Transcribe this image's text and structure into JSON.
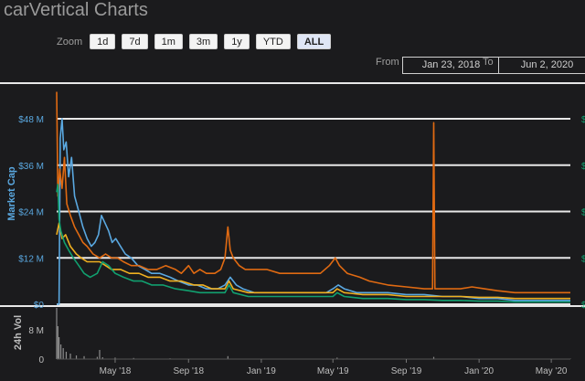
{
  "app": {
    "title": "carVertical Charts"
  },
  "zoom": {
    "label": "Zoom",
    "buttons": [
      "1d",
      "7d",
      "1m",
      "3m",
      "1y",
      "YTD",
      "ALL"
    ],
    "active": "ALL"
  },
  "range": {
    "from_label": "From",
    "from_value": "Jan 23, 2018",
    "to_label": "To",
    "to_value": "Jun 2, 2020"
  },
  "colors": {
    "market_cap": "#5aa8e0",
    "orange": "#e06a12",
    "yellow": "#f0b020",
    "green": "#11a06f",
    "grid": "#e8e8e8",
    "volume": "#8c8c8c"
  },
  "chart_data": {
    "type": "line",
    "title": "",
    "xlabel": "",
    "ylabel": "Market Cap",
    "ylabel_secondary": "24h Vol",
    "x_range": [
      "2018-01-23",
      "2020-06-02"
    ],
    "x_ticks": [
      "May '18",
      "Sep '18",
      "Jan '19",
      "May '19",
      "Sep '19",
      "Jan '20",
      "May '20"
    ],
    "y_ticks": [
      "$0",
      "$12 M",
      "$24 M",
      "$36 M",
      "$48 M"
    ],
    "ylim": [
      0,
      57
    ],
    "vol_ticks": [
      "0",
      "8 M"
    ],
    "vol_ylim": [
      0,
      14
    ],
    "right_axis_ticks": [
      "$",
      "$",
      "$",
      "$",
      "$",
      "$"
    ],
    "series": [
      {
        "color": "#5aa8e0",
        "points": [
          [
            "2018-01-23",
            0
          ],
          [
            "2018-01-27",
            0
          ],
          [
            "2018-01-29",
            43
          ],
          [
            "2018-02-01",
            48
          ],
          [
            "2018-02-04",
            40
          ],
          [
            "2018-02-08",
            42
          ],
          [
            "2018-02-12",
            33
          ],
          [
            "2018-02-17",
            38
          ],
          [
            "2018-02-22",
            28
          ],
          [
            "2018-03-01",
            24
          ],
          [
            "2018-03-08",
            20
          ],
          [
            "2018-03-15",
            17
          ],
          [
            "2018-03-22",
            15
          ],
          [
            "2018-03-28",
            16
          ],
          [
            "2018-04-03",
            18
          ],
          [
            "2018-04-08",
            23
          ],
          [
            "2018-04-14",
            21
          ],
          [
            "2018-04-20",
            19
          ],
          [
            "2018-04-26",
            16
          ],
          [
            "2018-05-02",
            17
          ],
          [
            "2018-05-10",
            15
          ],
          [
            "2018-05-18",
            13
          ],
          [
            "2018-05-28",
            12
          ],
          [
            "2018-06-08",
            10
          ],
          [
            "2018-06-20",
            9
          ],
          [
            "2018-07-01",
            8
          ],
          [
            "2018-07-15",
            8
          ],
          [
            "2018-08-01",
            7
          ],
          [
            "2018-08-15",
            6
          ],
          [
            "2018-09-01",
            5
          ],
          [
            "2018-09-15",
            5
          ],
          [
            "2018-10-01",
            4
          ],
          [
            "2018-10-20",
            4
          ],
          [
            "2018-11-01",
            5
          ],
          [
            "2018-11-10",
            7
          ],
          [
            "2018-11-20",
            5
          ],
          [
            "2018-12-01",
            4
          ],
          [
            "2018-12-20",
            3
          ],
          [
            "2019-01-10",
            3
          ],
          [
            "2019-02-01",
            3
          ],
          [
            "2019-03-01",
            3
          ],
          [
            "2019-04-01",
            3
          ],
          [
            "2019-04-20",
            3
          ],
          [
            "2019-05-01",
            4
          ],
          [
            "2019-05-10",
            5
          ],
          [
            "2019-05-20",
            4
          ],
          [
            "2019-06-10",
            3
          ],
          [
            "2019-07-01",
            3
          ],
          [
            "2019-08-01",
            3
          ],
          [
            "2019-09-01",
            2.5
          ],
          [
            "2019-10-01",
            2.5
          ],
          [
            "2019-11-01",
            2
          ],
          [
            "2019-12-01",
            2
          ],
          [
            "2020-01-01",
            1.5
          ],
          [
            "2020-02-01",
            1.5
          ],
          [
            "2020-03-01",
            1
          ],
          [
            "2020-04-01",
            1
          ],
          [
            "2020-05-01",
            1
          ],
          [
            "2020-06-02",
            1
          ]
        ]
      },
      {
        "color": "#e06a12",
        "points": [
          [
            "2018-01-23",
            55
          ],
          [
            "2018-01-25",
            28
          ],
          [
            "2018-01-28",
            35
          ],
          [
            "2018-02-01",
            30
          ],
          [
            "2018-02-05",
            38
          ],
          [
            "2018-02-09",
            26
          ],
          [
            "2018-02-15",
            23
          ],
          [
            "2018-02-22",
            20
          ],
          [
            "2018-03-01",
            18
          ],
          [
            "2018-03-08",
            16
          ],
          [
            "2018-03-15",
            15
          ],
          [
            "2018-03-25",
            13
          ],
          [
            "2018-04-05",
            12
          ],
          [
            "2018-04-15",
            13
          ],
          [
            "2018-04-25",
            12
          ],
          [
            "2018-05-05",
            12
          ],
          [
            "2018-05-15",
            11
          ],
          [
            "2018-05-28",
            10
          ],
          [
            "2018-06-10",
            10
          ],
          [
            "2018-06-25",
            9
          ],
          [
            "2018-07-10",
            9
          ],
          [
            "2018-07-25",
            10
          ],
          [
            "2018-08-10",
            9
          ],
          [
            "2018-08-20",
            8
          ],
          [
            "2018-09-01",
            10
          ],
          [
            "2018-09-10",
            8
          ],
          [
            "2018-09-20",
            9
          ],
          [
            "2018-10-01",
            8
          ],
          [
            "2018-10-15",
            8
          ],
          [
            "2018-10-25",
            9
          ],
          [
            "2018-11-01",
            12
          ],
          [
            "2018-11-06",
            20
          ],
          [
            "2018-11-10",
            14
          ],
          [
            "2018-11-15",
            12
          ],
          [
            "2018-11-25",
            10
          ],
          [
            "2018-12-05",
            9
          ],
          [
            "2018-12-20",
            9
          ],
          [
            "2019-01-10",
            9
          ],
          [
            "2019-02-01",
            8
          ],
          [
            "2019-03-01",
            8
          ],
          [
            "2019-03-20",
            8
          ],
          [
            "2019-04-10",
            8
          ],
          [
            "2019-04-25",
            10
          ],
          [
            "2019-05-05",
            12
          ],
          [
            "2019-05-12",
            10
          ],
          [
            "2019-05-25",
            8
          ],
          [
            "2019-06-15",
            7
          ],
          [
            "2019-07-01",
            6
          ],
          [
            "2019-08-01",
            5
          ],
          [
            "2019-09-01",
            4.5
          ],
          [
            "2019-10-01",
            4
          ],
          [
            "2019-10-15",
            4
          ],
          [
            "2019-10-17",
            47
          ],
          [
            "2019-10-19",
            4
          ],
          [
            "2019-11-01",
            4
          ],
          [
            "2019-12-01",
            4
          ],
          [
            "2019-12-20",
            4.5
          ],
          [
            "2020-01-10",
            4
          ],
          [
            "2020-02-01",
            3.5
          ],
          [
            "2020-03-01",
            3
          ],
          [
            "2020-04-01",
            3
          ],
          [
            "2020-05-01",
            3
          ],
          [
            "2020-06-02",
            3
          ]
        ]
      },
      {
        "color": "#f0b020",
        "points": [
          [
            "2018-01-23",
            18
          ],
          [
            "2018-01-27",
            21
          ],
          [
            "2018-02-01",
            17
          ],
          [
            "2018-02-07",
            18
          ],
          [
            "2018-02-15",
            15
          ],
          [
            "2018-02-25",
            13
          ],
          [
            "2018-03-05",
            12
          ],
          [
            "2018-03-15",
            11
          ],
          [
            "2018-03-25",
            11
          ],
          [
            "2018-04-05",
            11
          ],
          [
            "2018-04-15",
            10
          ],
          [
            "2018-04-25",
            9
          ],
          [
            "2018-05-10",
            9
          ],
          [
            "2018-05-25",
            8
          ],
          [
            "2018-06-10",
            8
          ],
          [
            "2018-06-25",
            7
          ],
          [
            "2018-07-15",
            7
          ],
          [
            "2018-08-01",
            6
          ],
          [
            "2018-08-20",
            6
          ],
          [
            "2018-09-10",
            5
          ],
          [
            "2018-09-25",
            5
          ],
          [
            "2018-10-10",
            4
          ],
          [
            "2018-11-01",
            4
          ],
          [
            "2018-11-08",
            6
          ],
          [
            "2018-11-15",
            4
          ],
          [
            "2018-12-10",
            3
          ],
          [
            "2019-01-10",
            3
          ],
          [
            "2019-02-10",
            3
          ],
          [
            "2019-03-10",
            3
          ],
          [
            "2019-04-10",
            3
          ],
          [
            "2019-05-01",
            3
          ],
          [
            "2019-05-08",
            4
          ],
          [
            "2019-05-20",
            3
          ],
          [
            "2019-06-20",
            2.5
          ],
          [
            "2019-08-01",
            2.5
          ],
          [
            "2019-09-01",
            2
          ],
          [
            "2019-10-01",
            2
          ],
          [
            "2019-11-01",
            2
          ],
          [
            "2019-12-01",
            2
          ],
          [
            "2020-01-01",
            1.8
          ],
          [
            "2020-02-01",
            1.8
          ],
          [
            "2020-03-01",
            1.5
          ],
          [
            "2020-04-01",
            1.5
          ],
          [
            "2020-05-01",
            1.5
          ],
          [
            "2020-06-02",
            1.5
          ]
        ]
      },
      {
        "color": "#11a06f",
        "points": [
          [
            "2018-01-23",
            29
          ],
          [
            "2018-01-25",
            31
          ],
          [
            "2018-01-27",
            22
          ],
          [
            "2018-01-30",
            19
          ],
          [
            "2018-02-05",
            16
          ],
          [
            "2018-02-12",
            14
          ],
          [
            "2018-02-20",
            12
          ],
          [
            "2018-03-01",
            10
          ],
          [
            "2018-03-10",
            8
          ],
          [
            "2018-03-20",
            7
          ],
          [
            "2018-04-01",
            8
          ],
          [
            "2018-04-10",
            11
          ],
          [
            "2018-04-20",
            10
          ],
          [
            "2018-05-01",
            8
          ],
          [
            "2018-05-15",
            7
          ],
          [
            "2018-06-01",
            6
          ],
          [
            "2018-06-15",
            6
          ],
          [
            "2018-07-01",
            5
          ],
          [
            "2018-07-20",
            5
          ],
          [
            "2018-08-10",
            4
          ],
          [
            "2018-09-01",
            3.5
          ],
          [
            "2018-09-20",
            3
          ],
          [
            "2018-10-10",
            3
          ],
          [
            "2018-11-01",
            3
          ],
          [
            "2018-11-08",
            5
          ],
          [
            "2018-11-15",
            3
          ],
          [
            "2018-12-10",
            2
          ],
          [
            "2019-01-10",
            2
          ],
          [
            "2019-02-10",
            2
          ],
          [
            "2019-03-10",
            2
          ],
          [
            "2019-04-10",
            2
          ],
          [
            "2019-05-01",
            2
          ],
          [
            "2019-05-08",
            3
          ],
          [
            "2019-05-20",
            2
          ],
          [
            "2019-06-20",
            1.5
          ],
          [
            "2019-08-01",
            1.5
          ],
          [
            "2019-09-01",
            1.2
          ],
          [
            "2019-10-01",
            1.2
          ],
          [
            "2019-11-01",
            1
          ],
          [
            "2019-12-01",
            1
          ],
          [
            "2020-01-01",
            0.8
          ],
          [
            "2020-02-01",
            0.8
          ],
          [
            "2020-03-01",
            0.6
          ],
          [
            "2020-04-01",
            0.6
          ],
          [
            "2020-05-01",
            0.6
          ],
          [
            "2020-06-02",
            0.6
          ]
        ]
      }
    ],
    "volume": [
      [
        "2018-01-23",
        14
      ],
      [
        "2018-01-25",
        9
      ],
      [
        "2018-01-27",
        6
      ],
      [
        "2018-01-30",
        4
      ],
      [
        "2018-02-03",
        3
      ],
      [
        "2018-02-08",
        2
      ],
      [
        "2018-02-15",
        1.5
      ],
      [
        "2018-02-25",
        1
      ],
      [
        "2018-03-10",
        0.8
      ],
      [
        "2018-04-01",
        0.6
      ],
      [
        "2018-04-05",
        2.5
      ],
      [
        "2018-04-10",
        0.5
      ],
      [
        "2018-05-01",
        0.4
      ],
      [
        "2018-06-01",
        0.3
      ],
      [
        "2018-08-01",
        0.2
      ],
      [
        "2018-11-06",
        0.8
      ],
      [
        "2019-01-01",
        0.1
      ],
      [
        "2019-05-08",
        0.4
      ],
      [
        "2019-10-17",
        0.6
      ],
      [
        "2020-06-02",
        0.1
      ]
    ]
  }
}
